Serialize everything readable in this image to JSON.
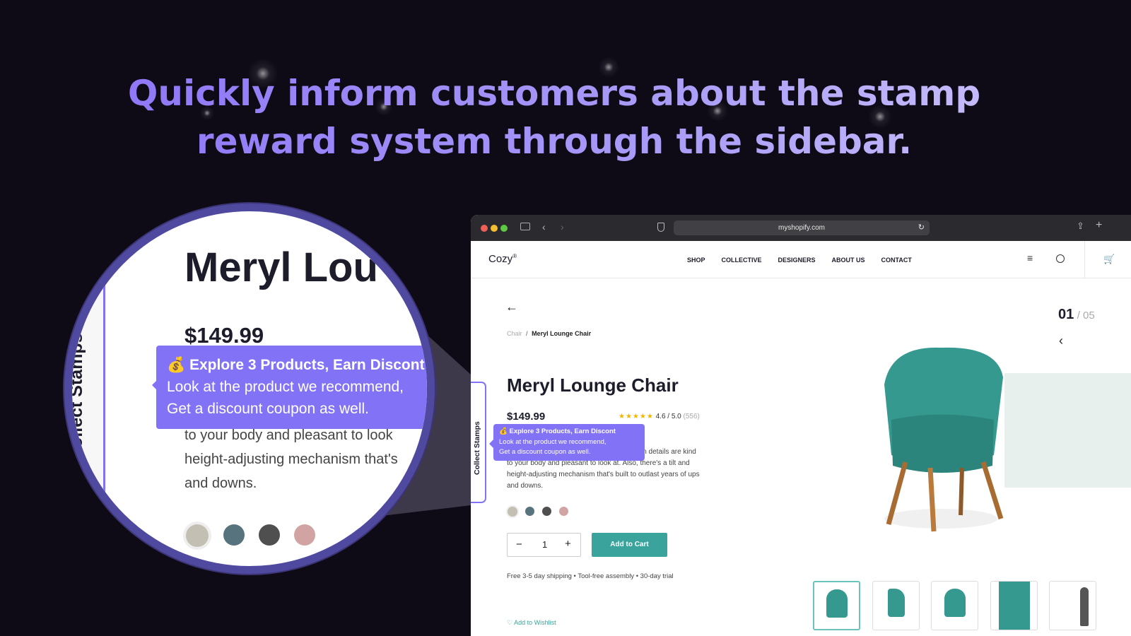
{
  "headline": {
    "line1": "Quickly inform customers about the stamp",
    "line2": "reward system through the sidebar."
  },
  "browser": {
    "url": "myshopify.com"
  },
  "store": {
    "logo": "Cozy",
    "logo_mark": "®",
    "nav": [
      "SHOP",
      "COLLECTIVE",
      "DESIGNERS",
      "ABOUT US",
      "CONTACT"
    ],
    "breadcrumb": {
      "parent": "Chair",
      "separator": "/",
      "current": "Meryl Lounge Chair"
    },
    "pager": {
      "current": "01",
      "total": "/ 05"
    },
    "product": {
      "title": "Meryl Lounge Chair",
      "price": "$149.99",
      "rating": "4.6 / 5.0",
      "reviews": "(556)",
      "stars": 4.6,
      "description_visible": "wn details are kind",
      "description": [
        "to your body and pleasant to look at. Also, there's a tilt and",
        "height-adjusting mechanism that's built to outlast years of ups",
        "and downs."
      ],
      "swatches": [
        "#c3bfb3",
        "#57737d",
        "#4f4f4f",
        "#d2a3a3"
      ],
      "quantity": "1",
      "add_to_cart": "Add to Cart",
      "perks": [
        "Free 3-5 day shipping",
        "Tool-free assembly",
        "30-day trial"
      ],
      "wishlist": "Add to Wishlist"
    },
    "sidebar": {
      "label": "Collect Stamps"
    },
    "tooltip": {
      "icon": "💰",
      "title": "Explore 3 Products, Earn Discont",
      "line1": "Look at the product we recommend,",
      "line2": "Get a discount coupon as well."
    }
  },
  "magnifier": {
    "title": "Meryl Lou",
    "price": "$149.99",
    "text1": "to your body and pleasant to look",
    "text2": "height-adjusting mechanism that's",
    "text3": "and downs."
  },
  "colors": {
    "accent": "#8273f6",
    "teal": "#3aa39b",
    "bg": "#0e0a16"
  }
}
